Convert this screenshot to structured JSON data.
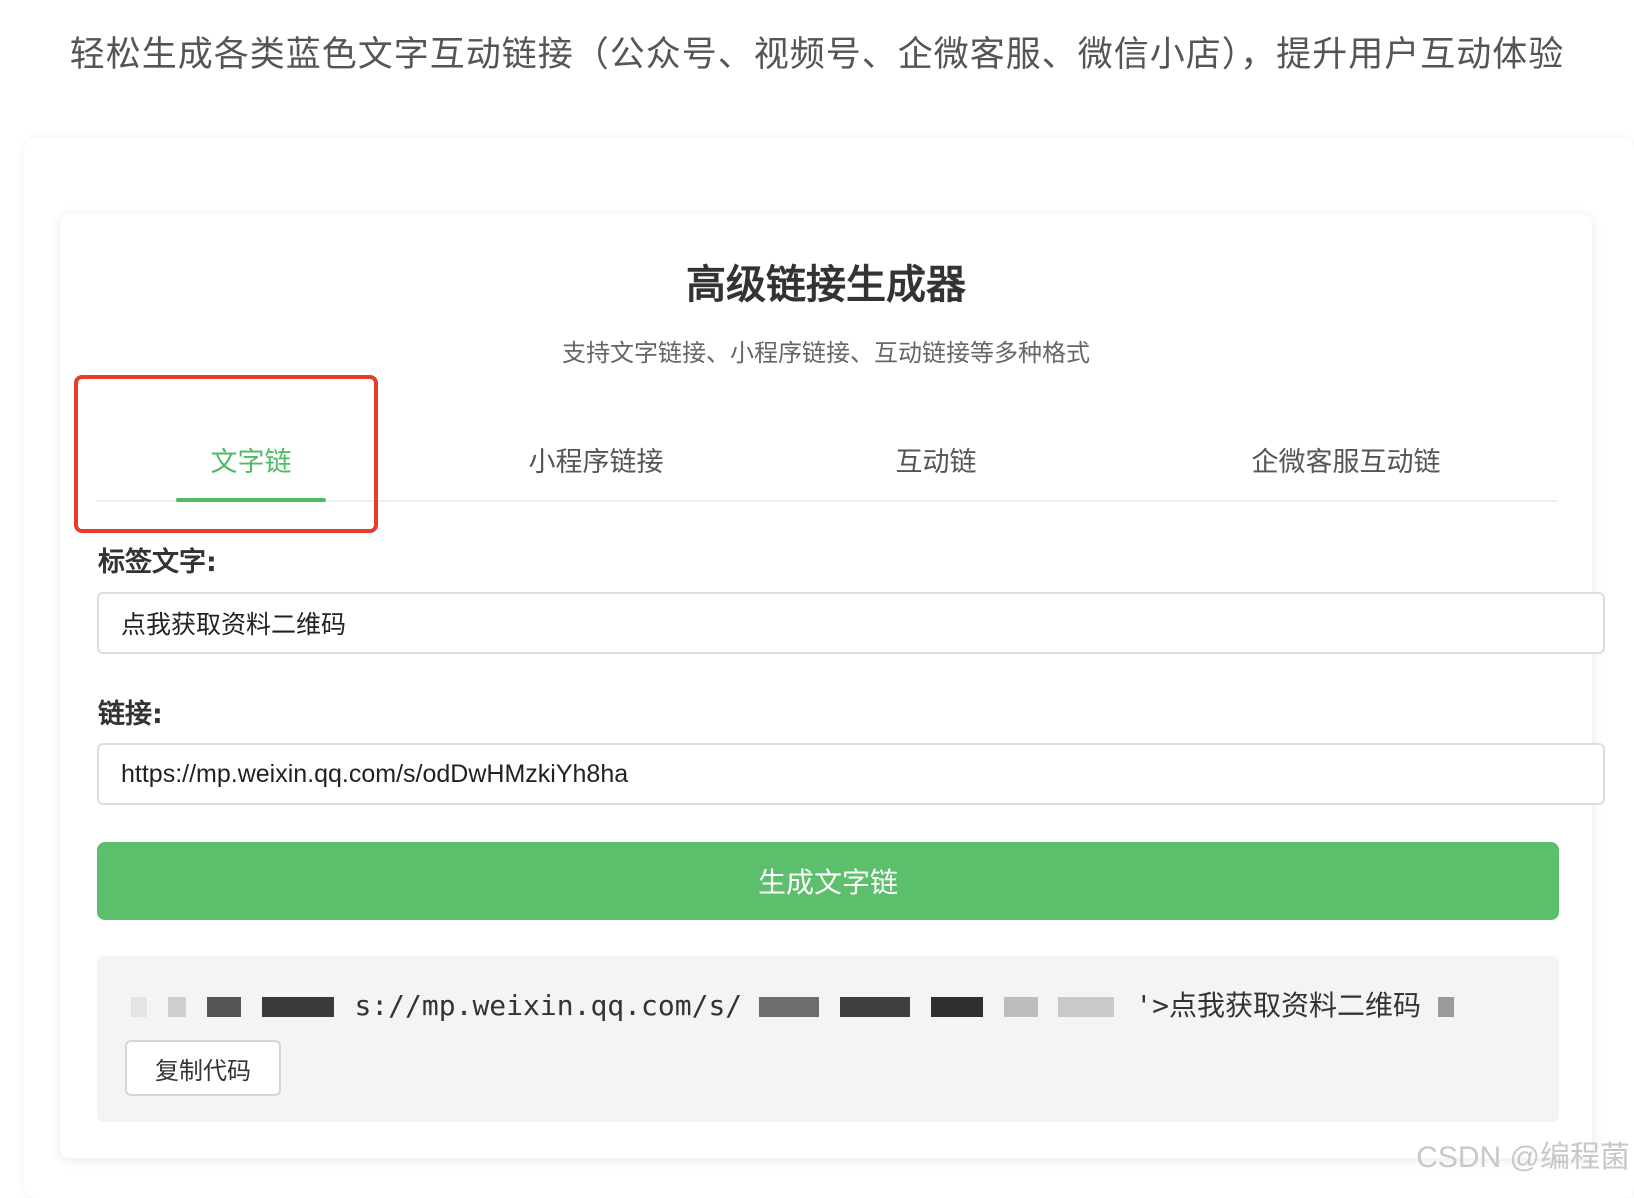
{
  "banner": {
    "text": "轻松生成各类蓝色文字互动链接（公众号、视频号、企微客服、微信小店），提升用户互动体验"
  },
  "generator": {
    "title": "高级链接生成器",
    "subtitle": "支持文字链接、小程序链接、互动链接等多种格式"
  },
  "tabs": [
    {
      "label": "文字链",
      "active": true
    },
    {
      "label": "小程序链接",
      "active": false
    },
    {
      "label": "互动链",
      "active": false
    },
    {
      "label": "企微客服互动链",
      "active": false
    }
  ],
  "form": {
    "label_text_label": "标签文字:",
    "label_text_value": "点我获取资料二维码",
    "link_label": "链接:",
    "link_value": "https://mp.weixin.qq.com/s/odDwHMzkiYh8ha"
  },
  "generate_button": {
    "label": "生成文字链"
  },
  "output": {
    "code_mid": "s://mp.weixin.qq.com/s/",
    "code_tail": "'>点我获取资料二维码",
    "copy_label": "复制代码"
  },
  "watermark": "CSDN @编程菌",
  "colors": {
    "accent_green": "#4fbb62",
    "button_green": "#5bbf6b",
    "highlight_red": "#e53c2c"
  }
}
